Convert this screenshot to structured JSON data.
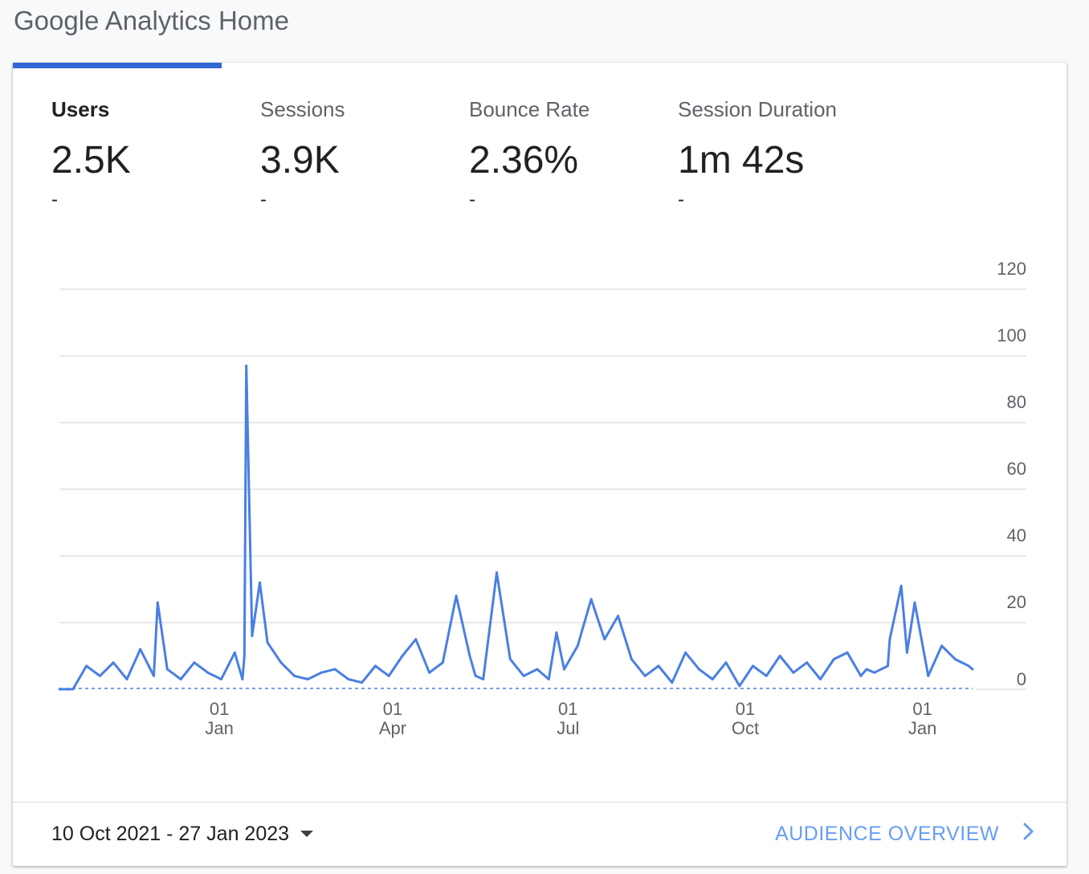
{
  "page": {
    "title": "Google Analytics Home"
  },
  "colors": {
    "accent": "#3367d6",
    "series": "#4a7fe3",
    "grid": "#e0e0e0",
    "link": "#669df6"
  },
  "metrics": [
    {
      "label": "Users",
      "value": "2.5K",
      "delta": "-",
      "active": true
    },
    {
      "label": "Sessions",
      "value": "3.9K",
      "delta": "-",
      "active": false
    },
    {
      "label": "Bounce Rate",
      "value": "2.36%",
      "delta": "-",
      "active": false
    },
    {
      "label": "Session Duration",
      "value": "1m 42s",
      "delta": "-",
      "active": false
    }
  ],
  "chart_data": {
    "type": "line",
    "title": "",
    "xlabel": "",
    "ylabel": "",
    "ylim": [
      0,
      120
    ],
    "y_ticks": [
      0,
      20,
      40,
      60,
      80,
      100,
      120
    ],
    "x_range": [
      "2021-10-10",
      "2023-01-27"
    ],
    "x_tick_labels": [
      {
        "day": "01",
        "month": "Jan"
      },
      {
        "day": "01",
        "month": "Apr"
      },
      {
        "day": "01",
        "month": "Jul"
      },
      {
        "day": "01",
        "month": "Oct"
      },
      {
        "day": "01",
        "month": "Jan"
      }
    ],
    "x_tick_dates": [
      "2022-01-01",
      "2022-04-01",
      "2022-07-01",
      "2022-10-01",
      "2023-01-01"
    ],
    "grid": true,
    "series": [
      {
        "color": "#4a7fe3",
        "dates": [
          "2021-10-10",
          "2021-10-17",
          "2021-10-24",
          "2021-10-31",
          "2021-11-07",
          "2021-11-14",
          "2021-11-21",
          "2021-11-28",
          "2021-11-30",
          "2021-12-05",
          "2021-12-12",
          "2021-12-19",
          "2021-12-26",
          "2022-01-02",
          "2022-01-09",
          "2022-01-13",
          "2022-01-14",
          "2022-01-15",
          "2022-01-18",
          "2022-01-22",
          "2022-01-26",
          "2022-02-02",
          "2022-02-09",
          "2022-02-16",
          "2022-02-23",
          "2022-03-02",
          "2022-03-09",
          "2022-03-16",
          "2022-03-23",
          "2022-03-30",
          "2022-04-06",
          "2022-04-13",
          "2022-04-20",
          "2022-04-27",
          "2022-05-04",
          "2022-05-11",
          "2022-05-14",
          "2022-05-18",
          "2022-05-25",
          "2022-06-01",
          "2022-06-08",
          "2022-06-15",
          "2022-06-21",
          "2022-06-25",
          "2022-06-29",
          "2022-07-06",
          "2022-07-13",
          "2022-07-20",
          "2022-07-27",
          "2022-08-03",
          "2022-08-10",
          "2022-08-17",
          "2022-08-24",
          "2022-08-31",
          "2022-09-07",
          "2022-09-14",
          "2022-09-21",
          "2022-09-28",
          "2022-10-05",
          "2022-10-12",
          "2022-10-19",
          "2022-10-26",
          "2022-11-02",
          "2022-11-09",
          "2022-11-16",
          "2022-11-23",
          "2022-11-30",
          "2022-12-03",
          "2022-12-07",
          "2022-12-14",
          "2022-12-15",
          "2022-12-21",
          "2022-12-24",
          "2022-12-28",
          "2023-01-04",
          "2023-01-11",
          "2023-01-18",
          "2023-01-25",
          "2023-01-27"
        ],
        "values": [
          0,
          0,
          7,
          4,
          8,
          3,
          12,
          4,
          26,
          6,
          3,
          8,
          5,
          3,
          11,
          3,
          10,
          97,
          16,
          32,
          14,
          8,
          4,
          3,
          5,
          6,
          3,
          2,
          7,
          4,
          10,
          15,
          5,
          8,
          28,
          10,
          4,
          3,
          35,
          9,
          4,
          6,
          3,
          17,
          6,
          13,
          27,
          15,
          22,
          9,
          4,
          7,
          2,
          11,
          6,
          3,
          8,
          1,
          7,
          4,
          10,
          5,
          8,
          3,
          9,
          11,
          4,
          6,
          5,
          7,
          15,
          31,
          11,
          26,
          4,
          13,
          9,
          7,
          6
        ]
      }
    ]
  },
  "footer": {
    "date_range": "10 Oct 2021 - 27 Jan 2023",
    "link_label": "AUDIENCE OVERVIEW"
  }
}
